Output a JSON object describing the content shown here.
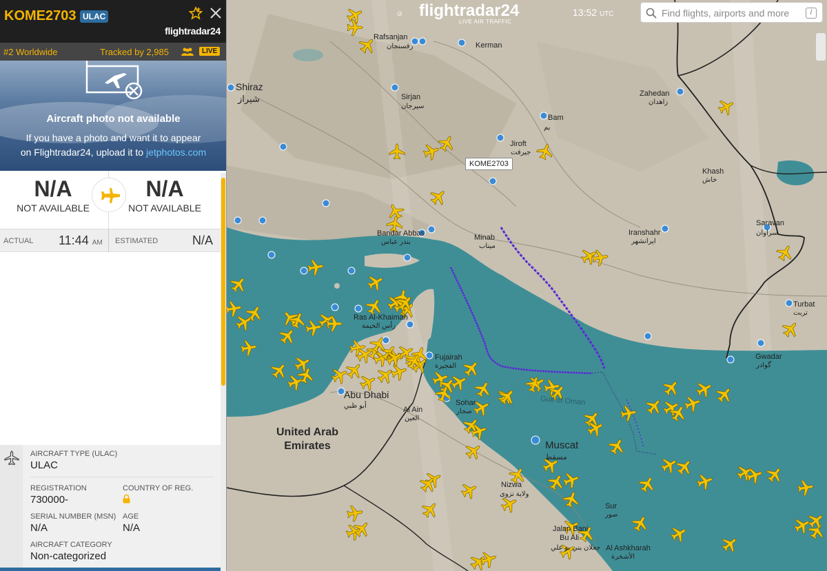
{
  "panel": {
    "callsign": "KOME2703",
    "type_badge": "ULAC",
    "logo": "flightradar24",
    "rank": "#2 Worldwide",
    "tracked": "Tracked by 2,985",
    "live": "LIVE",
    "photo_title": "Aircraft photo not available",
    "photo_help_1": "If you have a photo and want it to appear",
    "photo_help_2": "on Flightradar24, upload it to",
    "photo_link": "jetphotos.com",
    "origin_code": "N/A",
    "origin_city": "NOT AVAILABLE",
    "dest_code": "N/A",
    "dest_city": "NOT AVAILABLE",
    "actual_label": "ACTUAL",
    "actual_time": "11:44",
    "actual_ampm": "AM",
    "estimated_label": "ESTIMATED",
    "estimated_time": "N/A",
    "details": {
      "aircraft_type_label": "AIRCRAFT TYPE",
      "aircraft_type_code": "(ULAC)",
      "aircraft_type_value": "ULAC",
      "registration_label": "REGISTRATION",
      "registration_value": "730000-",
      "country_label": "COUNTRY OF REG.",
      "serial_label": "SERIAL NUMBER (MSN)",
      "serial_value": "N/A",
      "age_label": "AGE",
      "age_value": "N/A",
      "category_label": "AIRCRAFT CATEGORY",
      "category_value": "Non-categorized"
    }
  },
  "topbar": {
    "logo_text": "flightradar24",
    "logo_sub": "LIVE AIR TRAFFIC",
    "time": "13:52",
    "timezone": "UTC",
    "search_placeholder": "Find flights, airports and more",
    "slash_key": "/"
  },
  "map": {
    "flight_tag": "KOME2703",
    "labels": {
      "rafsanjan": "Rafsanjan",
      "rafsanjan_ar": "رفسنجان",
      "kerman": "Kerman",
      "shiraz": "Shiraz",
      "shiraz_ar": "شیراز",
      "sirjan": "Sirjan",
      "sirjan_ar": "سیرجان",
      "bam": "Bam",
      "bam_ar": "بم",
      "zahedan": "Zahedan",
      "zahedan_ar": "زاهدان",
      "jiroft": "Jiroft",
      "jiroft_ar": "جیرفت",
      "khash": "Khash",
      "khash_ar": "خاش",
      "bandar_abbas": "Bandar Abbas",
      "bandar_abbas_ar": "بندر عباس",
      "minab": "Minab",
      "minab_ar": "میناب",
      "iranshahr": "Iranshahr",
      "iranshahr_ar": "ایرانشهر",
      "saravan": "Saravan",
      "saravan_ar": "سراوان",
      "turbat": "Turbat",
      "turbat_ar": "تربت",
      "gwadar": "Gwadar",
      "gwadar_ar": "گوادر",
      "ras_al_khaimah": "Ras Al-Khaimah",
      "ras_al_khaimah_ar": "رأس الخيمة",
      "fujairah": "Fujairah",
      "fujairah_ar": "الفجيرة",
      "abu_dhabi": "Abu Dhabi",
      "abu_dhabi_ar": "أبو ظبي",
      "sohar": "Sohar",
      "sohar_ar": "صحار",
      "al_ain": "Al Ain",
      "al_ain_ar": "العين",
      "gulf_of_oman": "Gulf of Oman",
      "uae_1": "United Arab",
      "uae_2": "Emirates",
      "muscat": "Muscat",
      "muscat_ar": "مسقط",
      "nizwa": "Nizwa",
      "nizwa_ar": "ولاية نزوى",
      "sur": "Sur",
      "sur_ar": "صور",
      "jalan_bani_bu_ali_1": "Jalan Bani",
      "jalan_bani_bu_ali_2": "Bu Ali",
      "jalan_bani_bu_ali_ar": "جعلان بني بو علي",
      "al_ashkharah": "Al Ashkharah",
      "al_ashkharah_ar": "الأشخرة"
    }
  },
  "colors": {
    "accent": "#f4b400",
    "panel_header": "#1f1f1f",
    "badge_blue": "#2d6c9e",
    "sea": "#3f8e96",
    "land": "#c9c2b4",
    "track": "#5a2ad6"
  }
}
